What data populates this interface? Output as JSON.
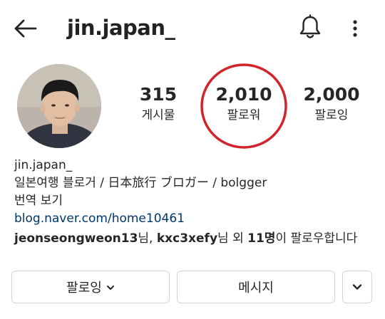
{
  "header": {
    "username": "jin.japan_",
    "icons": {
      "back": "arrow-left-icon",
      "notifications": "bell-icon",
      "more": "vertical-dots-icon"
    }
  },
  "stats": {
    "posts": {
      "value": "315",
      "label": "게시물"
    },
    "followers": {
      "value": "2,010",
      "label": "팔로워"
    },
    "following": {
      "value": "2,000",
      "label": "팔로잉"
    }
  },
  "bio": {
    "name": "jin.japan_",
    "description": "일본여행 블로거 / 日本旅行 ブロガー / bolgger",
    "translate": "번역 보기",
    "link": "blog.naver.com/home10461",
    "followed_by": {
      "user1": "jeonseongweon13",
      "suffix1": "님, ",
      "user2": "kxc3xefy",
      "suffix2": "님 외 ",
      "count": "11명",
      "suffix3": "이 팔로우합니다"
    }
  },
  "actions": {
    "following_label": "팔로잉",
    "message_label": "메시지"
  },
  "colors": {
    "highlight": "#d2232a",
    "link": "#00376b",
    "text": "#262626",
    "button_border": "#d4d4d4"
  }
}
